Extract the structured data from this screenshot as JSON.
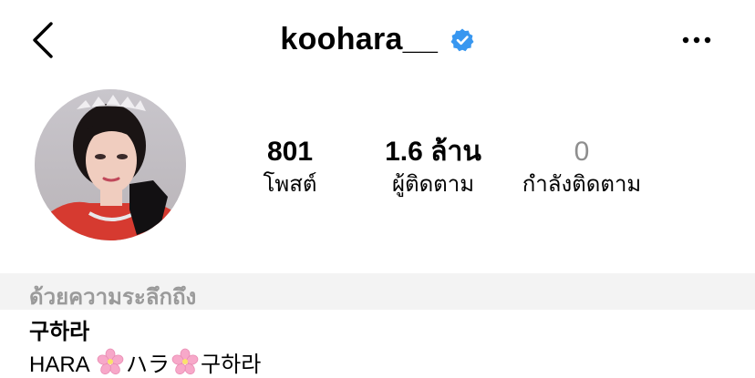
{
  "header": {
    "username": "koohara__",
    "verified": true,
    "back_icon": "chevron-left-icon",
    "more_icon": "more-horizontal-icon",
    "verified_color": "#3897f0"
  },
  "profile": {
    "stats": {
      "posts": {
        "count": "801",
        "label": "โพสต์"
      },
      "followers": {
        "count": "1.6 ล้าน",
        "label": "ผู้ติดตาม"
      },
      "following": {
        "count": "0",
        "label": "กำลังติดตาม"
      }
    }
  },
  "memorial": {
    "text": "ด้วยความระลึกถึง"
  },
  "bio": {
    "name": "구하라",
    "line_parts": [
      "HARA ",
      "ハラ",
      "구하라"
    ],
    "flower_icon": "cherry-blossom-icon"
  }
}
